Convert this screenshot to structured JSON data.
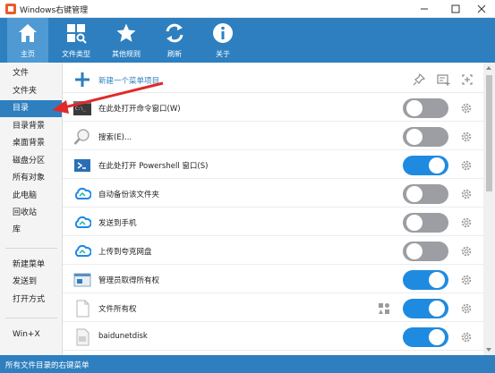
{
  "window": {
    "title": "Windows右键管理"
  },
  "toolbar": {
    "items": [
      {
        "label": "主页",
        "icon": "home-icon"
      },
      {
        "label": "文件类型",
        "icon": "file-type-icon"
      },
      {
        "label": "其他规则",
        "icon": "star-icon"
      },
      {
        "label": "刷新",
        "icon": "refresh-icon"
      },
      {
        "label": "关于",
        "icon": "info-icon"
      }
    ],
    "active_index": 0
  },
  "sidebar": {
    "items": [
      "文件",
      "文件夹",
      "目录",
      "目录背景",
      "桌面背景",
      "磁盘分区",
      "所有对象",
      "此电脑",
      "回收站",
      "库",
      "新建菜单",
      "发送到",
      "打开方式",
      "Win+X"
    ],
    "selected": "目录"
  },
  "content": {
    "new_item_label": "新建一个菜单项目",
    "rows": [
      {
        "label": "在此处打开命令窗口(W)",
        "on": false,
        "icon": "cmd-icon"
      },
      {
        "label": "搜索(E)...",
        "on": false,
        "icon": "search-icon"
      },
      {
        "label": "在此处打开 Powershell 窗口(S)",
        "on": true,
        "icon": "powershell-icon"
      },
      {
        "label": "自动备份该文件夹",
        "on": false,
        "icon": "cloud-icon"
      },
      {
        "label": "发送到手机",
        "on": false,
        "icon": "cloud-icon"
      },
      {
        "label": "上传到夸克网盘",
        "on": false,
        "icon": "cloud-icon"
      },
      {
        "label": "管理员取得所有权",
        "on": true,
        "icon": "admin-window-icon"
      },
      {
        "label": "文件所有权",
        "on": true,
        "icon": "document-icon"
      },
      {
        "label": "baidunetdisk",
        "on": true,
        "icon": "document-icon"
      }
    ]
  },
  "status": {
    "text": "所有文件目录的右键菜单"
  },
  "colors": {
    "accent": "#2e7fbf",
    "toggle_on": "#1f8be0",
    "toggle_off": "#9c9ea3",
    "arrow": "#e02a2a"
  }
}
